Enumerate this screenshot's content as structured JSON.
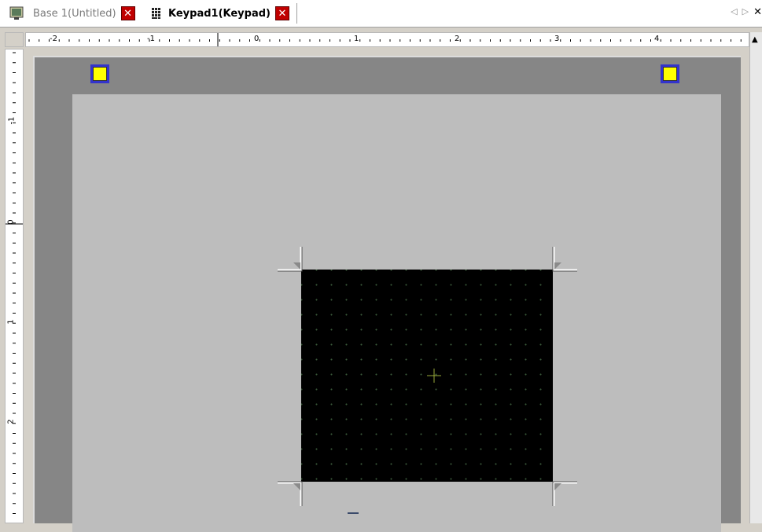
{
  "tabs": [
    {
      "label": "Base 1(Untitled)",
      "active": false,
      "icon": "monitor-icon"
    },
    {
      "label": "Keypad1(Keypad)",
      "active": true,
      "icon": "keypad-icon"
    }
  ],
  "tab_scroll": {
    "prev": "◁",
    "next": "▷",
    "close": "✕"
  },
  "ruler_h": {
    "labels": [
      "-2",
      "-1",
      "0",
      "1",
      "2",
      "3",
      "4"
    ]
  },
  "ruler_v": {
    "labels": [
      "-1",
      "0",
      "1",
      "2"
    ]
  },
  "scroll": {
    "up": "▲"
  },
  "colors": {
    "anchor_fill": "#ffff00",
    "anchor_border": "#3333cc",
    "close_bg": "#c00000",
    "keypad_bg": "#000000",
    "screen_bg": "#bdbdbd",
    "frame_bg": "#868686"
  }
}
